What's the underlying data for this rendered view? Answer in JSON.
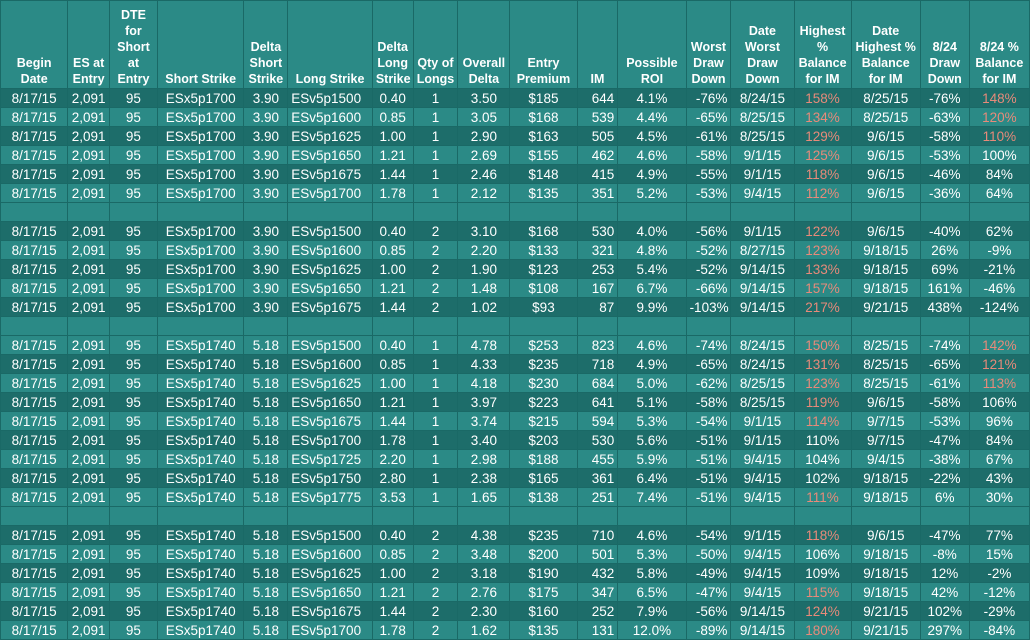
{
  "headers": [
    "Begin Date",
    "ES at Entry",
    "DTE for Short at Entry",
    "Short Strike",
    "Delta Short Strike",
    "Long Strike",
    "Delta Long Strike",
    "Qty of Longs",
    "Overall Delta",
    "Entry Premium",
    "IM",
    "Possible ROI",
    "Worst Draw Down",
    "Date Worst Draw Down",
    "Highest % Balance for IM",
    "Date Highest % Balance for IM",
    "8/24 Draw Down",
    "8/24 % Balance for IM"
  ],
  "colors": {
    "background": "#2b8a86",
    "alt_row": "#1d6d6a",
    "highlight_text": "#e88a7a",
    "text": "#ffffff"
  },
  "rows": [
    {
      "cells": [
        "8/17/15",
        "2,091",
        "95",
        "ESx5p1700",
        "3.90",
        "ESv5p1500",
        "0.40",
        "1",
        "3.50",
        "$185",
        "644",
        "4.1%",
        "-76%",
        "8/24/15",
        "158%",
        "8/25/15",
        "-76%",
        "148%"
      ],
      "hl": [
        14,
        17
      ]
    },
    {
      "cells": [
        "8/17/15",
        "2,091",
        "95",
        "ESx5p1700",
        "3.90",
        "ESv5p1600",
        "0.85",
        "1",
        "3.05",
        "$168",
        "539",
        "4.4%",
        "-65%",
        "8/25/15",
        "134%",
        "8/25/15",
        "-63%",
        "120%"
      ],
      "hl": [
        14,
        17
      ]
    },
    {
      "cells": [
        "8/17/15",
        "2,091",
        "95",
        "ESx5p1700",
        "3.90",
        "ESv5p1625",
        "1.00",
        "1",
        "2.90",
        "$163",
        "505",
        "4.5%",
        "-61%",
        "8/25/15",
        "129%",
        "9/6/15",
        "-58%",
        "110%"
      ],
      "hl": [
        14,
        17
      ]
    },
    {
      "cells": [
        "8/17/15",
        "2,091",
        "95",
        "ESx5p1700",
        "3.90",
        "ESv5p1650",
        "1.21",
        "1",
        "2.69",
        "$155",
        "462",
        "4.6%",
        "-58%",
        "9/1/15",
        "125%",
        "9/6/15",
        "-53%",
        "100%"
      ],
      "hl": [
        14
      ]
    },
    {
      "cells": [
        "8/17/15",
        "2,091",
        "95",
        "ESx5p1700",
        "3.90",
        "ESv5p1675",
        "1.44",
        "1",
        "2.46",
        "$148",
        "415",
        "4.9%",
        "-55%",
        "9/1/15",
        "118%",
        "9/6/15",
        "-46%",
        "84%"
      ],
      "hl": [
        14
      ]
    },
    {
      "cells": [
        "8/17/15",
        "2,091",
        "95",
        "ESx5p1700",
        "3.90",
        "ESv5p1700",
        "1.78",
        "1",
        "2.12",
        "$135",
        "351",
        "5.2%",
        "-53%",
        "9/4/15",
        "112%",
        "9/6/15",
        "-36%",
        "64%"
      ],
      "hl": [
        14
      ]
    },
    {
      "blank": true
    },
    {
      "cells": [
        "8/17/15",
        "2,091",
        "95",
        "ESx5p1700",
        "3.90",
        "ESv5p1500",
        "0.40",
        "2",
        "3.10",
        "$168",
        "530",
        "4.0%",
        "-56%",
        "9/1/15",
        "122%",
        "9/6/15",
        "-40%",
        "62%"
      ],
      "hl": [
        14
      ]
    },
    {
      "cells": [
        "8/17/15",
        "2,091",
        "95",
        "ESx5p1700",
        "3.90",
        "ESv5p1600",
        "0.85",
        "2",
        "2.20",
        "$133",
        "321",
        "4.8%",
        "-52%",
        "8/27/15",
        "123%",
        "9/18/15",
        "26%",
        "-9%"
      ],
      "hl": [
        14
      ]
    },
    {
      "cells": [
        "8/17/15",
        "2,091",
        "95",
        "ESx5p1700",
        "3.90",
        "ESv5p1625",
        "1.00",
        "2",
        "1.90",
        "$123",
        "253",
        "5.4%",
        "-52%",
        "9/14/15",
        "133%",
        "9/18/15",
        "69%",
        "-21%"
      ],
      "hl": [
        14
      ]
    },
    {
      "cells": [
        "8/17/15",
        "2,091",
        "95",
        "ESx5p1700",
        "3.90",
        "ESv5p1650",
        "1.21",
        "2",
        "1.48",
        "$108",
        "167",
        "6.7%",
        "-66%",
        "9/14/15",
        "157%",
        "9/18/15",
        "161%",
        "-46%"
      ],
      "hl": [
        14
      ]
    },
    {
      "cells": [
        "8/17/15",
        "2,091",
        "95",
        "ESx5p1700",
        "3.90",
        "ESv5p1675",
        "1.44",
        "2",
        "1.02",
        "$93",
        "87",
        "9.9%",
        "-103%",
        "9/14/15",
        "217%",
        "9/21/15",
        "438%",
        "-124%"
      ],
      "hl": [
        14
      ]
    },
    {
      "blank": true
    },
    {
      "cells": [
        "8/17/15",
        "2,091",
        "95",
        "ESx5p1740",
        "5.18",
        "ESv5p1500",
        "0.40",
        "1",
        "4.78",
        "$253",
        "823",
        "4.6%",
        "-74%",
        "8/24/15",
        "150%",
        "8/25/15",
        "-74%",
        "142%"
      ],
      "hl": [
        14,
        17
      ]
    },
    {
      "cells": [
        "8/17/15",
        "2,091",
        "95",
        "ESx5p1740",
        "5.18",
        "ESv5p1600",
        "0.85",
        "1",
        "4.33",
        "$235",
        "718",
        "4.9%",
        "-65%",
        "8/24/15",
        "131%",
        "8/25/15",
        "-65%",
        "121%"
      ],
      "hl": [
        14,
        17
      ]
    },
    {
      "cells": [
        "8/17/15",
        "2,091",
        "95",
        "ESx5p1740",
        "5.18",
        "ESv5p1625",
        "1.00",
        "1",
        "4.18",
        "$230",
        "684",
        "5.0%",
        "-62%",
        "8/25/15",
        "123%",
        "8/25/15",
        "-61%",
        "113%"
      ],
      "hl": [
        14,
        17
      ]
    },
    {
      "cells": [
        "8/17/15",
        "2,091",
        "95",
        "ESx5p1740",
        "5.18",
        "ESv5p1650",
        "1.21",
        "1",
        "3.97",
        "$223",
        "641",
        "5.1%",
        "-58%",
        "8/25/15",
        "119%",
        "9/6/15",
        "-58%",
        "106%"
      ],
      "hl": [
        14
      ]
    },
    {
      "cells": [
        "8/17/15",
        "2,091",
        "95",
        "ESx5p1740",
        "5.18",
        "ESv5p1675",
        "1.44",
        "1",
        "3.74",
        "$215",
        "594",
        "5.3%",
        "-54%",
        "9/1/15",
        "114%",
        "9/7/15",
        "-53%",
        "96%"
      ],
      "hl": [
        14
      ]
    },
    {
      "cells": [
        "8/17/15",
        "2,091",
        "95",
        "ESx5p1740",
        "5.18",
        "ESv5p1700",
        "1.78",
        "1",
        "3.40",
        "$203",
        "530",
        "5.6%",
        "-51%",
        "9/1/15",
        "110%",
        "9/7/15",
        "-47%",
        "84%"
      ],
      "hl": []
    },
    {
      "cells": [
        "8/17/15",
        "2,091",
        "95",
        "ESx5p1740",
        "5.18",
        "ESv5p1725",
        "2.20",
        "1",
        "2.98",
        "$188",
        "455",
        "5.9%",
        "-51%",
        "9/4/15",
        "104%",
        "9/4/15",
        "-38%",
        "67%"
      ],
      "hl": []
    },
    {
      "cells": [
        "8/17/15",
        "2,091",
        "95",
        "ESx5p1740",
        "5.18",
        "ESv5p1750",
        "2.80",
        "1",
        "2.38",
        "$165",
        "361",
        "6.4%",
        "-51%",
        "9/4/15",
        "102%",
        "9/18/15",
        "-22%",
        "43%"
      ],
      "hl": []
    },
    {
      "cells": [
        "8/17/15",
        "2,091",
        "95",
        "ESx5p1740",
        "5.18",
        "ESv5p1775",
        "3.53",
        "1",
        "1.65",
        "$138",
        "251",
        "7.4%",
        "-51%",
        "9/4/15",
        "111%",
        "9/18/15",
        "6%",
        "30%"
      ],
      "hl": [
        14
      ]
    },
    {
      "blank": true
    },
    {
      "cells": [
        "8/17/15",
        "2,091",
        "95",
        "ESx5p1740",
        "5.18",
        "ESv5p1500",
        "0.40",
        "2",
        "4.38",
        "$235",
        "710",
        "4.6%",
        "-54%",
        "9/1/15",
        "118%",
        "9/6/15",
        "-47%",
        "77%"
      ],
      "hl": [
        14
      ]
    },
    {
      "cells": [
        "8/17/15",
        "2,091",
        "95",
        "ESx5p1740",
        "5.18",
        "ESv5p1600",
        "0.85",
        "2",
        "3.48",
        "$200",
        "501",
        "5.3%",
        "-50%",
        "9/4/15",
        "106%",
        "9/18/15",
        "-8%",
        "15%"
      ],
      "hl": []
    },
    {
      "cells": [
        "8/17/15",
        "2,091",
        "95",
        "ESx5p1740",
        "5.18",
        "ESv5p1625",
        "1.00",
        "2",
        "3.18",
        "$190",
        "432",
        "5.8%",
        "-49%",
        "9/4/15",
        "109%",
        "9/18/15",
        "12%",
        "-2%"
      ],
      "hl": []
    },
    {
      "cells": [
        "8/17/15",
        "2,091",
        "95",
        "ESx5p1740",
        "5.18",
        "ESv5p1650",
        "1.21",
        "2",
        "2.76",
        "$175",
        "347",
        "6.5%",
        "-47%",
        "9/4/15",
        "115%",
        "9/18/15",
        "42%",
        "-12%"
      ],
      "hl": [
        14
      ]
    },
    {
      "cells": [
        "8/17/15",
        "2,091",
        "95",
        "ESx5p1740",
        "5.18",
        "ESv5p1675",
        "1.44",
        "2",
        "2.30",
        "$160",
        "252",
        "7.9%",
        "-56%",
        "9/14/15",
        "124%",
        "9/21/15",
        "102%",
        "-29%"
      ],
      "hl": [
        14
      ]
    },
    {
      "cells": [
        "8/17/15",
        "2,091",
        "95",
        "ESx5p1740",
        "5.18",
        "ESv5p1700",
        "1.78",
        "2",
        "1.62",
        "$135",
        "131",
        "12.0%",
        "-89%",
        "9/14/15",
        "180%",
        "9/21/15",
        "297%",
        "-84%"
      ],
      "hl": [
        14
      ]
    }
  ]
}
